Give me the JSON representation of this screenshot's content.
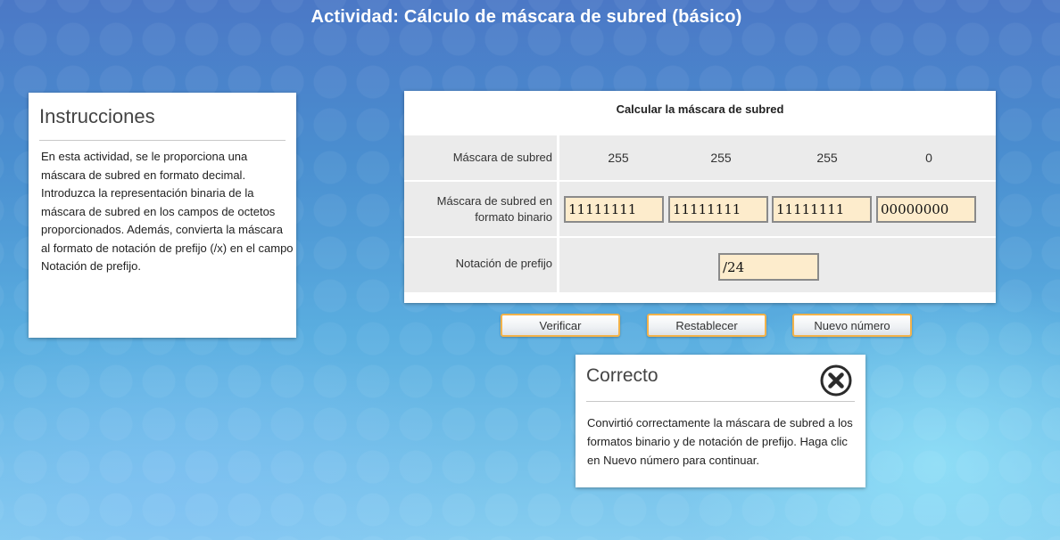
{
  "page": {
    "title": "Actividad: Cálculo de máscara de subred (básico)"
  },
  "instructions": {
    "heading": "Instrucciones",
    "body": "En esta actividad, se le proporciona una máscara de subred en formato decimal. Introduzca la representación binaria de la máscara de subred en los campos de octetos proporcionados. Además, convierta la máscara al formato de notación de prefijo (/x) en el campo Notación de prefijo."
  },
  "calculator": {
    "title": "Calcular la máscara de subred",
    "decimal_row": {
      "label": "Máscara de subred",
      "octets": [
        "255",
        "255",
        "255",
        "0"
      ]
    },
    "binary_row": {
      "label": "Máscara de subred en formato binario",
      "octets": [
        "11111111",
        "11111111",
        "11111111",
        "00000000"
      ]
    },
    "prefix_row": {
      "label": "Notación de prefijo",
      "value": "/24"
    }
  },
  "buttons": {
    "verify": "Verificar",
    "reset": "Restablecer",
    "new_number": "Nuevo número"
  },
  "feedback": {
    "heading": "Correcto",
    "message": "Convirtió correctamente la máscara de subred a los formatos binario y de notación de prefijo. Haga clic en Nuevo número para continuar.",
    "close_icon": "close-circle-icon"
  },
  "colors": {
    "input_background": "#fdeccc",
    "button_border": "#f2b24a",
    "row_background": "#ebebeb"
  }
}
